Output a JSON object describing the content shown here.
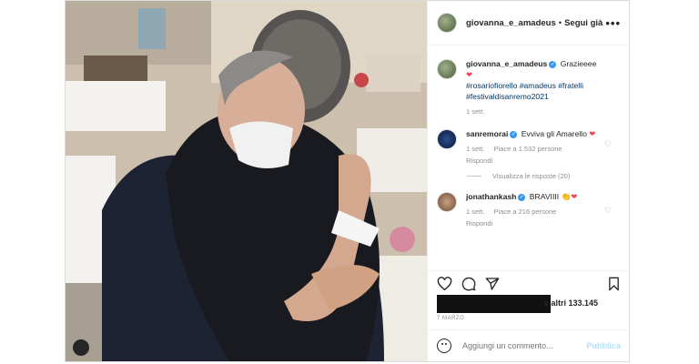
{
  "post": {
    "username": "giovanna_e_amadeus",
    "follow_label": "Segui già",
    "more_label": "•••"
  },
  "caption": {
    "username": "giovanna_e_amadeus",
    "text": "Grazieeee",
    "hashtags": "#rosariofiorello #amadeus #fratelli #festivaldisanremo2021",
    "time": "1 sett."
  },
  "comments": [
    {
      "username": "sanremorai",
      "text": "Evviva gli Amarello",
      "time": "1 sett.",
      "likes": "Piace a 1.532 persone",
      "reply_label": "Rispondi",
      "view_replies": "Visualizza le risposte (20)"
    },
    {
      "username": "jonathankash",
      "text": "BRAVIIII",
      "time": "1 sett.",
      "likes": "Piace a 216 persone",
      "reply_label": "Rispondi"
    }
  ],
  "likes_suffix": "e altri 133.145",
  "date": "7 MARZO",
  "comment_input": {
    "placeholder": "Aggiungi un commento...",
    "publish_label": "Pubblica"
  },
  "colors": {
    "accent": "#3897f0",
    "heart": "#ed4956"
  }
}
